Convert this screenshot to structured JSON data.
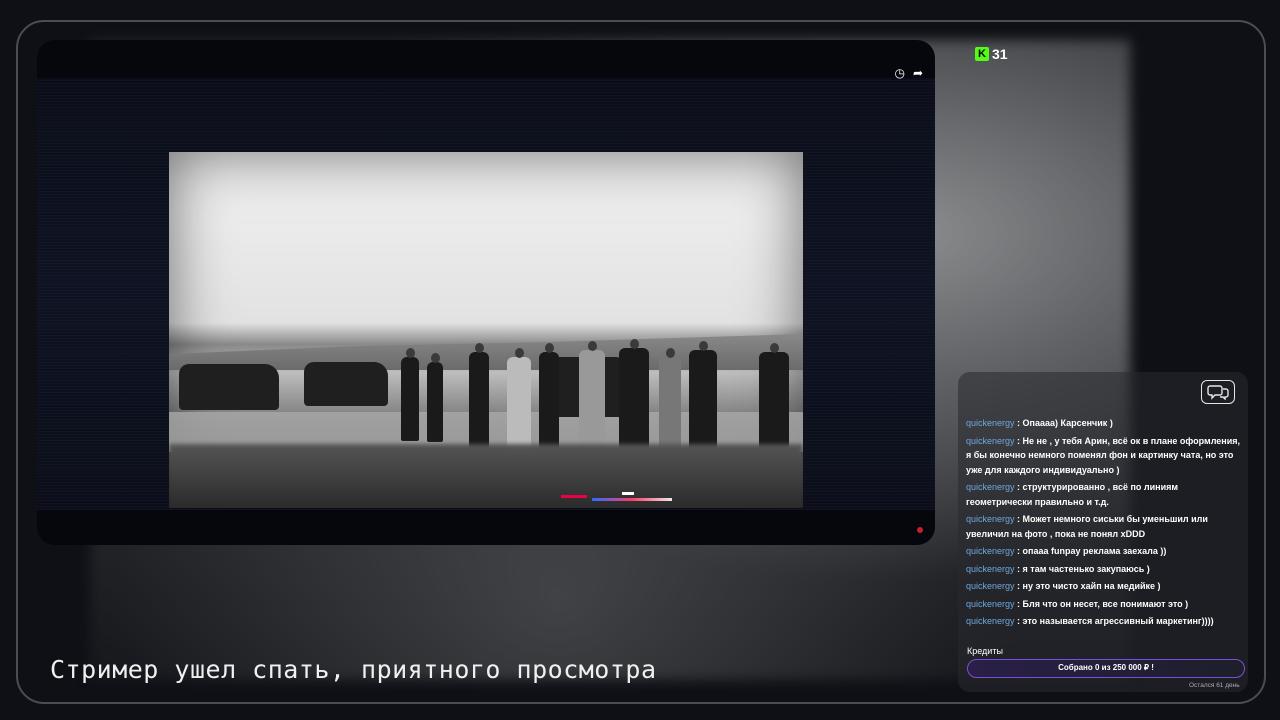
{
  "brand": {
    "platform_icon": "kick-logo",
    "number": "31"
  },
  "player": {
    "icons": [
      "clock-icon",
      "share-icon"
    ],
    "content_description_icon": "video-frame"
  },
  "chat": {
    "messages": [
      {
        "user": "quickenergy",
        "text": ": Опаааа) Карсенчик )"
      },
      {
        "user": "quickenergy",
        "text": ": Не не , у тебя Арин, всё ок в плане оформления, я бы конечно немного поменял фон и картинку чата, но это уже для каждого индивидуально )"
      },
      {
        "user": "quickenergy",
        "text": ": структурированно , всё по линиям геометрически правильно и т.д."
      },
      {
        "user": "quickenergy",
        "text": ": Может немного сиськи бы уменьшил или увеличил на фото , пока не понял xDDD"
      },
      {
        "user": "quickenergy",
        "text": ": опааа funpay реклама заехала ))"
      },
      {
        "user": "quickenergy",
        "text": ": я там частенько закупаюсь )"
      },
      {
        "user": "quickenergy",
        "text": ": ну это чисто хайп на медийке )"
      },
      {
        "user": "quickenergy",
        "text": ": Бля что он несет, все понимают это )"
      },
      {
        "user": "quickenergy",
        "text": ": это называется агрессивный маркетинг))))"
      }
    ]
  },
  "credits": {
    "label": "Кредиты",
    "progress_text": "Собрано 0  из 250 000 ₽ !",
    "remaining": "Остался 61 день",
    "collected_value": 0,
    "goal_value": 250000
  },
  "overlay": {
    "subtitle": "Стример ушел спать, приятного просмотра"
  },
  "colors": {
    "accent": "#53fc18",
    "username": "#6fa8dc",
    "credits_border": "#7a4fd8"
  }
}
